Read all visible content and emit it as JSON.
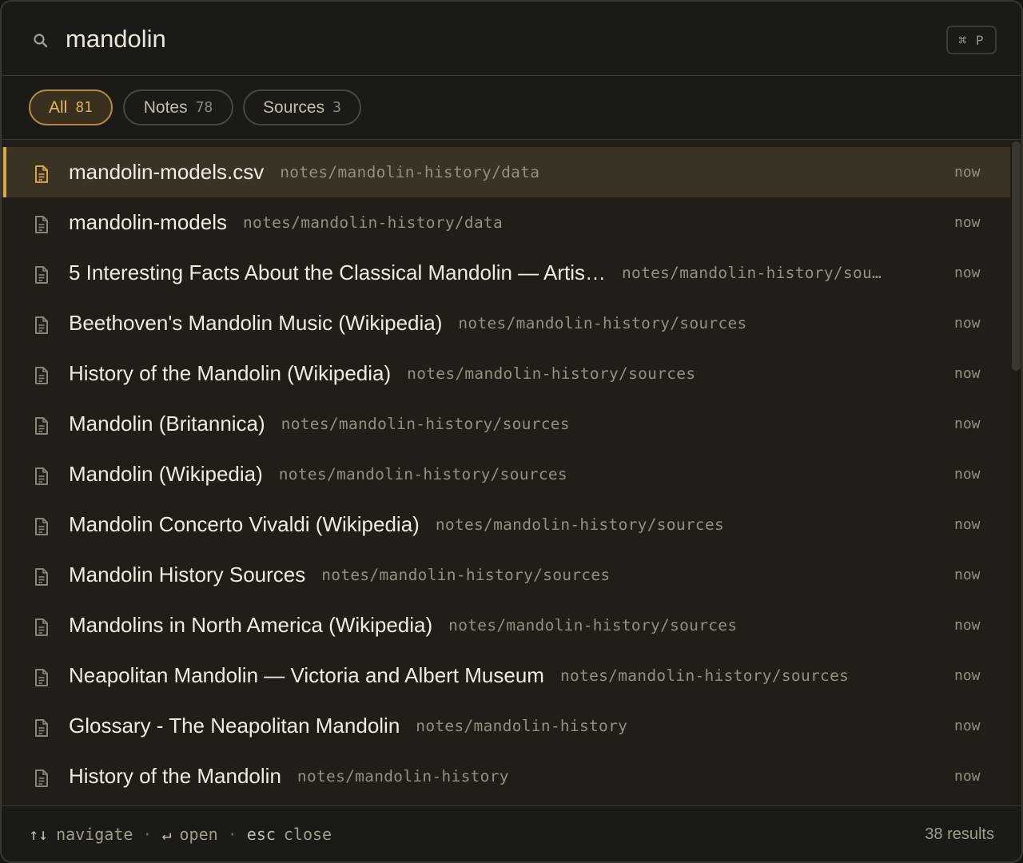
{
  "search": {
    "query": "mandolin",
    "shortcut": "⌘ P"
  },
  "filters": [
    {
      "label": "All",
      "count": "81",
      "active": true
    },
    {
      "label": "Notes",
      "count": "78",
      "active": false
    },
    {
      "label": "Sources",
      "count": "3",
      "active": false
    }
  ],
  "results": [
    {
      "title": "mandolin-models.csv",
      "path": "notes/mandolin-history/data",
      "time": "now",
      "icon": "file-csv-icon",
      "selected": true
    },
    {
      "title": "mandolin-models",
      "path": "notes/mandolin-history/data",
      "time": "now",
      "icon": "document-icon"
    },
    {
      "title": "5 Interesting Facts About the Classical Mandolin — Artis…",
      "path": "notes/mandolin-history/sou…",
      "time": "now",
      "icon": "document-icon"
    },
    {
      "title": "Beethoven's Mandolin Music (Wikipedia)",
      "path": "notes/mandolin-history/sources",
      "time": "now",
      "icon": "document-icon"
    },
    {
      "title": "History of the Mandolin (Wikipedia)",
      "path": "notes/mandolin-history/sources",
      "time": "now",
      "icon": "document-icon"
    },
    {
      "title": "Mandolin (Britannica)",
      "path": "notes/mandolin-history/sources",
      "time": "now",
      "icon": "document-icon"
    },
    {
      "title": "Mandolin (Wikipedia)",
      "path": "notes/mandolin-history/sources",
      "time": "now",
      "icon": "document-icon"
    },
    {
      "title": "Mandolin Concerto Vivaldi (Wikipedia)",
      "path": "notes/mandolin-history/sources",
      "time": "now",
      "icon": "document-icon"
    },
    {
      "title": "Mandolin History Sources",
      "path": "notes/mandolin-history/sources",
      "time": "now",
      "icon": "document-icon"
    },
    {
      "title": "Mandolins in North America (Wikipedia)",
      "path": "notes/mandolin-history/sources",
      "time": "now",
      "icon": "document-icon"
    },
    {
      "title": "Neapolitan Mandolin — Victoria and Albert Museum",
      "path": "notes/mandolin-history/sources",
      "time": "now",
      "icon": "document-icon"
    },
    {
      "title": "Glossary - The Neapolitan Mandolin",
      "path": "notes/mandolin-history",
      "time": "now",
      "icon": "document-icon"
    },
    {
      "title": "History of the Mandolin",
      "path": "notes/mandolin-history",
      "time": "now",
      "icon": "document-icon"
    }
  ],
  "footer": {
    "hint_navigate_key": "↑↓",
    "hint_navigate": "navigate",
    "hint_open_key": "↵",
    "hint_open": "open",
    "hint_close_key": "esc",
    "hint_close": "close",
    "separator": "·",
    "result_count": "38 results"
  },
  "colors": {
    "accent": "#d9a64a",
    "background": "#211e19",
    "selected_row": "#3a3223"
  }
}
